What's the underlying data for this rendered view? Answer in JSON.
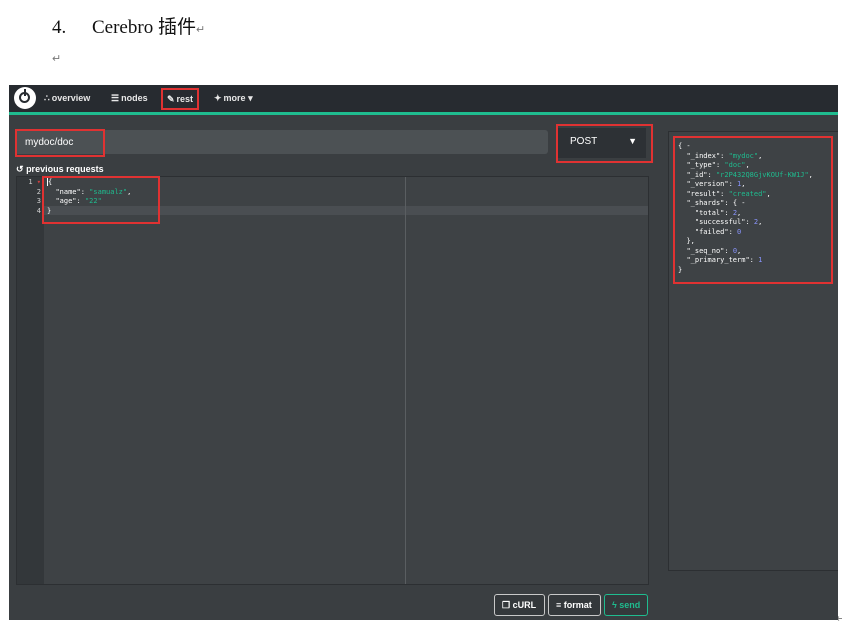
{
  "document": {
    "heading_number": "4.",
    "heading_text": "Cerebro 插件",
    "paragraph_mark": "↵",
    "edge_mark": "↵"
  },
  "navbar": {
    "items": [
      {
        "label": "overview",
        "icon": "sitemap-icon"
      },
      {
        "label": "nodes",
        "icon": "list-icon"
      },
      {
        "label": "rest",
        "icon": "edit-icon"
      },
      {
        "label": "more",
        "icon": "magic-wand-icon"
      }
    ],
    "accent_color": "#1fbc8f"
  },
  "request": {
    "url_value": "mydoc/doc",
    "method": "POST",
    "previous_requests_label": "previous requests"
  },
  "editor": {
    "line_numbers": [
      "1",
      "2",
      "3",
      "4"
    ],
    "open_brace": "{",
    "close_brace": "}",
    "name_key": "\"name\"",
    "name_value": "\"samualz\"",
    "age_key": "\"age\"",
    "age_value": "\"22\""
  },
  "actions": {
    "curl_label": "cURL",
    "format_label": "format",
    "send_label": "send"
  },
  "response": {
    "open": "{ -",
    "index_key": "\"_index\"",
    "index_value": "\"mydoc\"",
    "type_key": "\"_type\"",
    "type_value": "\"doc\"",
    "id_key": "\"_id\"",
    "id_value": "\"r2P432Q8GjvKOUf-KW1J\"",
    "version_key": "\"_version\"",
    "version_value": "1",
    "result_key": "\"result\"",
    "result_value": "\"created\"",
    "shards_key": "\"_shards\"",
    "shards_open": "{ -",
    "total_key": "\"total\"",
    "total_value": "2",
    "successful_key": "\"successful\"",
    "successful_value": "2",
    "failed_key": "\"failed\"",
    "failed_value": "0",
    "shards_close": "},",
    "seq_key": "\"_seq_no\"",
    "seq_value": "0",
    "term_key": "\"_primary_term\"",
    "term_value": "1",
    "close": "}"
  }
}
